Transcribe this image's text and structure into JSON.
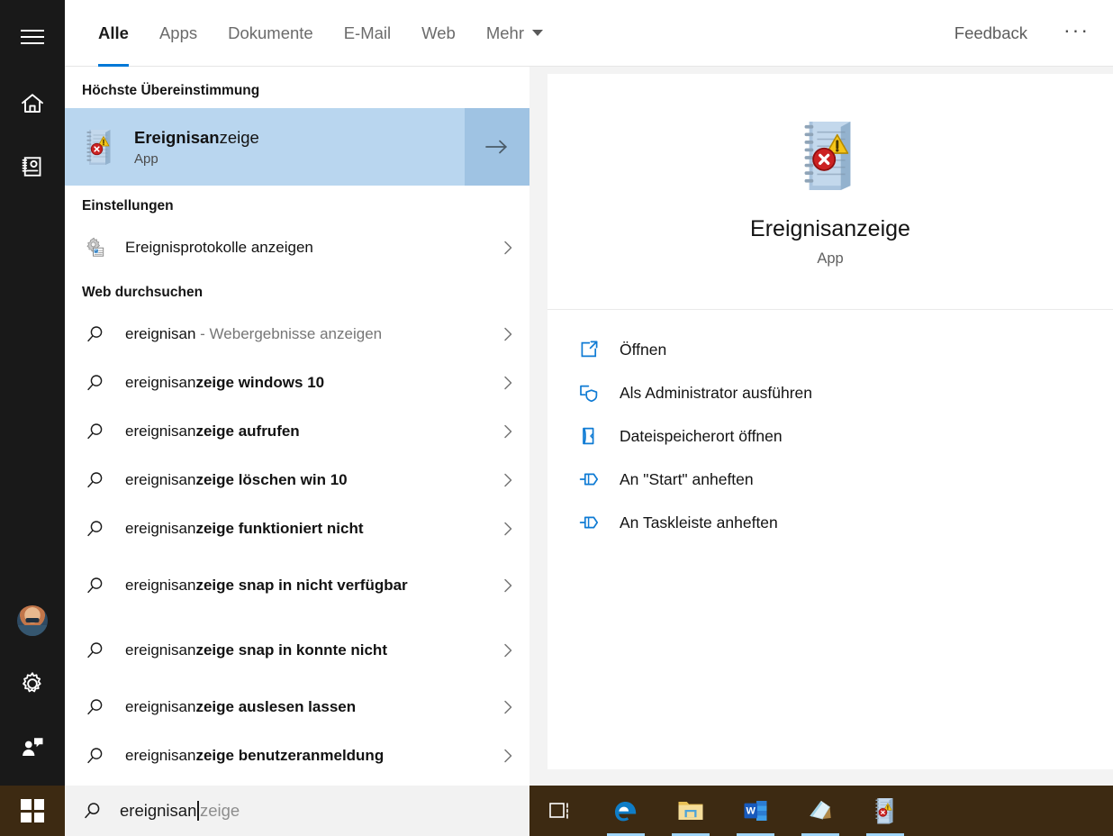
{
  "sidebar": {
    "items": [
      {
        "name": "hamburger-menu",
        "icon": "hamburger-icon"
      },
      {
        "name": "home",
        "icon": "home-icon"
      },
      {
        "name": "notebook",
        "icon": "notebook-icon"
      },
      {
        "name": "account",
        "icon": "avatar-icon"
      },
      {
        "name": "settings",
        "icon": "gear-icon"
      },
      {
        "name": "feedback",
        "icon": "feedback-person-icon"
      }
    ]
  },
  "header": {
    "tabs": [
      {
        "label": "Alle",
        "active": true
      },
      {
        "label": "Apps",
        "active": false
      },
      {
        "label": "Dokumente",
        "active": false
      },
      {
        "label": "E-Mail",
        "active": false
      },
      {
        "label": "Web",
        "active": false
      },
      {
        "label": "Mehr",
        "active": false,
        "has_caret": true
      }
    ],
    "feedback_label": "Feedback",
    "more_label": "···",
    "accent_color": "#0078d7"
  },
  "results": {
    "best_match_title": "Höchste Übereinstimmung",
    "best_match": {
      "name_prefix": "Ereignisan",
      "name_suffix": "zeige",
      "subtitle": "App",
      "icon": "event-viewer-icon",
      "highlight_color": "#b9d6ef",
      "arrow_color": "#9fc3e3"
    },
    "settings_title": "Einstellungen",
    "settings_items": [
      {
        "label": "Ereignisprotokolle anzeigen",
        "icon": "control-panel-gear-icon"
      }
    ],
    "web_title": "Web durchsuchen",
    "web_items": [
      {
        "prefix": "ereignisan",
        "suffix": "",
        "trailer": " - Webergebnisse anzeigen",
        "icon": "search-icon"
      },
      {
        "prefix": "ereignisan",
        "suffix": "zeige windows 10",
        "trailer": "",
        "icon": "search-icon"
      },
      {
        "prefix": "ereignisan",
        "suffix": "zeige aufrufen",
        "trailer": "",
        "icon": "search-icon"
      },
      {
        "prefix": "ereignisan",
        "suffix": "zeige löschen win 10",
        "trailer": "",
        "icon": "search-icon"
      },
      {
        "prefix": "ereignisan",
        "suffix": "zeige funktioniert nicht",
        "trailer": "",
        "icon": "search-icon"
      },
      {
        "prefix": "ereignisan",
        "suffix": "zeige snap in nicht verfügbar",
        "trailer": "",
        "icon": "search-icon"
      },
      {
        "prefix": "ereignisan",
        "suffix": "zeige snap in konnte nicht",
        "trailer": "",
        "icon": "search-icon"
      },
      {
        "prefix": "ereignisan",
        "suffix": "zeige auslesen lassen",
        "trailer": "",
        "icon": "search-icon"
      },
      {
        "prefix": "ereignisan",
        "suffix": "zeige benutzeranmeldung",
        "trailer": "",
        "icon": "search-icon"
      }
    ]
  },
  "preview": {
    "app_name": "Ereignisanzeige",
    "app_type": "App",
    "icon": "event-viewer-icon",
    "actions": [
      {
        "label": "Öffnen",
        "icon": "open-external-icon"
      },
      {
        "label": "Als Administrator ausführen",
        "icon": "shield-admin-icon"
      },
      {
        "label": "Dateispeicherort öffnen",
        "icon": "folder-location-icon"
      },
      {
        "label": "An \"Start\" anheften",
        "icon": "pin-icon"
      },
      {
        "label": "An Taskleiste anheften",
        "icon": "pin-icon"
      }
    ]
  },
  "search": {
    "typed": "ereignisan",
    "suggestion": "zeige",
    "icon": "search-icon"
  },
  "taskbar": {
    "background_color": "#3d2a12",
    "indicator_color": "#9fd4f7",
    "start_icon": "windows-logo-icon",
    "items": [
      {
        "name": "task-view",
        "running": false
      },
      {
        "name": "microsoft-edge",
        "running": true
      },
      {
        "name": "file-explorer",
        "running": true
      },
      {
        "name": "microsoft-word",
        "running": true
      },
      {
        "name": "sticky-notes",
        "running": true
      },
      {
        "name": "event-viewer",
        "running": true
      }
    ]
  }
}
